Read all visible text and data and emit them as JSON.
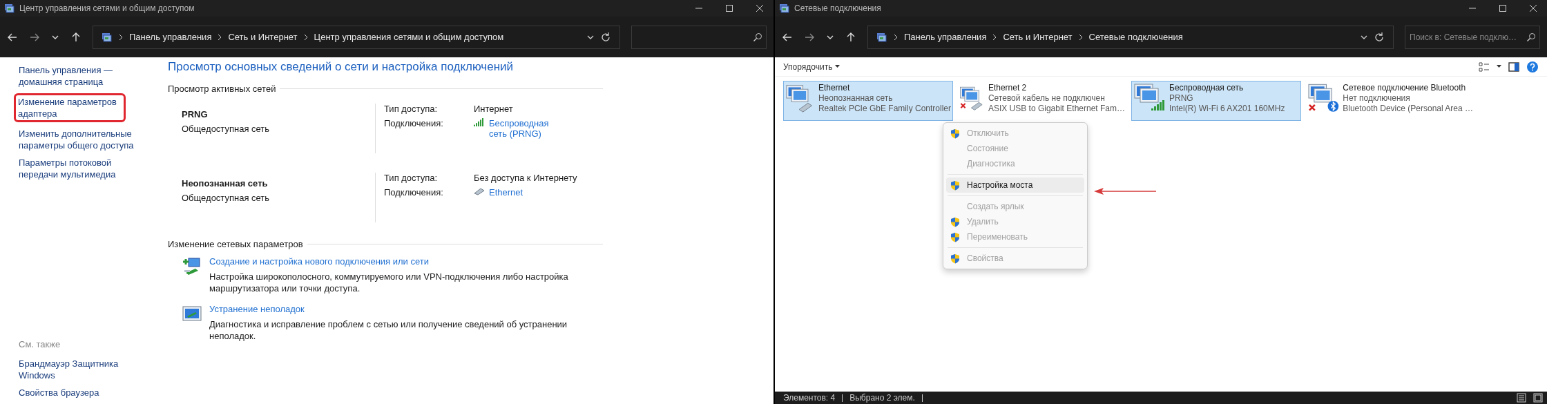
{
  "left_window": {
    "title": "Центр управления сетями и общим доступом",
    "breadcrumb": [
      "Панель управления",
      "Сеть и Интернет",
      "Центр управления сетями и общим доступом"
    ],
    "sidebar": {
      "links": [
        {
          "label": "Панель управления — домашняя страница",
          "highlighted": false
        },
        {
          "label": "Изменение параметров адаптера",
          "highlighted": true
        },
        {
          "label": "Изменить дополнительные параметры общего доступа",
          "highlighted": false
        },
        {
          "label": "Параметры потоковой передачи мультимедиа",
          "highlighted": false
        }
      ],
      "see_also_heading": "См. также",
      "see_also": [
        "Брандмауэр Защитника Windows",
        "Свойства браузера"
      ]
    },
    "main": {
      "heading": "Просмотр основных сведений о сети и настройка подключений",
      "active_heading": "Просмотр активных сетей",
      "networks": [
        {
          "name": "PRNG",
          "category": "Общедоступная сеть",
          "access_label": "Тип доступа:",
          "access": "Интернет",
          "conn_label": "Подключения:",
          "kind": "wifi",
          "connection": "Беспроводная сеть (PRNG)"
        },
        {
          "name": "Неопознанная сеть",
          "category": "Общедоступная сеть",
          "access_label": "Тип доступа:",
          "access": "Без доступа к Интернету",
          "conn_label": "Подключения:",
          "kind": "wired",
          "connection": "Ethernet"
        }
      ],
      "change_heading": "Изменение сетевых параметров",
      "tasks": [
        {
          "kind": "setup",
          "title": "Создание и настройка нового подключения или сети",
          "description": "Настройка широкополосного, коммутируемого или VPN-подключения либо настройка маршрутизатора или точки доступа."
        },
        {
          "kind": "troubleshoot",
          "title": "Устранение неполадок",
          "description": "Диагностика и исправление проблем с сетью или получение сведений об устранении неполадок."
        }
      ]
    }
  },
  "right_window": {
    "title": "Сетевые подключения",
    "breadcrumb": [
      "Панель управления",
      "Сеть и Интернет",
      "Сетевые подключения"
    ],
    "search": {
      "placeholder": "Поиск в: Сетевые подклю…"
    },
    "organize": "Упорядочить",
    "adapters": [
      {
        "kind": "wired",
        "name": "Ethernet",
        "status": "Неопознанная сеть",
        "device": "Realtek PCIe GbE Family Controller",
        "selected": true,
        "disconnected": false
      },
      {
        "kind": "wired",
        "name": "Ethernet 2",
        "status": "Сетевой кабель не подключен",
        "device": "ASIX USB to Gigabit Ethernet Fam…",
        "selected": false,
        "disconnected": true
      },
      {
        "kind": "wifi",
        "name": "Беспроводная сеть",
        "status": "PRNG",
        "device": "Intel(R) Wi-Fi 6 AX201 160MHz",
        "selected": true,
        "disconnected": false
      },
      {
        "kind": "bluetooth",
        "name": "Сетевое подключение Bluetooth",
        "status": "Нет подключения",
        "device": "Bluetooth Device (Personal Area …",
        "selected": false,
        "disconnected": true
      }
    ],
    "context_menu": [
      {
        "kind": "item",
        "label": "Отключить",
        "shield": true,
        "disabled": true,
        "selected": false
      },
      {
        "kind": "item",
        "label": "Состояние",
        "shield": false,
        "disabled": true,
        "selected": false
      },
      {
        "kind": "item",
        "label": "Диагностика",
        "shield": false,
        "disabled": true,
        "selected": false
      },
      {
        "kind": "separator"
      },
      {
        "kind": "item",
        "label": "Настройка моста",
        "shield": true,
        "disabled": false,
        "selected": true
      },
      {
        "kind": "separator"
      },
      {
        "kind": "item",
        "label": "Создать ярлык",
        "shield": false,
        "disabled": true,
        "selected": false
      },
      {
        "kind": "item",
        "label": "Удалить",
        "shield": true,
        "disabled": true,
        "selected": false
      },
      {
        "kind": "item",
        "label": "Переименовать",
        "shield": true,
        "disabled": true,
        "selected": false
      },
      {
        "kind": "separator"
      },
      {
        "kind": "item",
        "label": "Свойства",
        "shield": true,
        "disabled": true,
        "selected": false
      }
    ],
    "status_bar": {
      "items": "Элементов: 4",
      "selected": "Выбрано 2 элем."
    }
  }
}
